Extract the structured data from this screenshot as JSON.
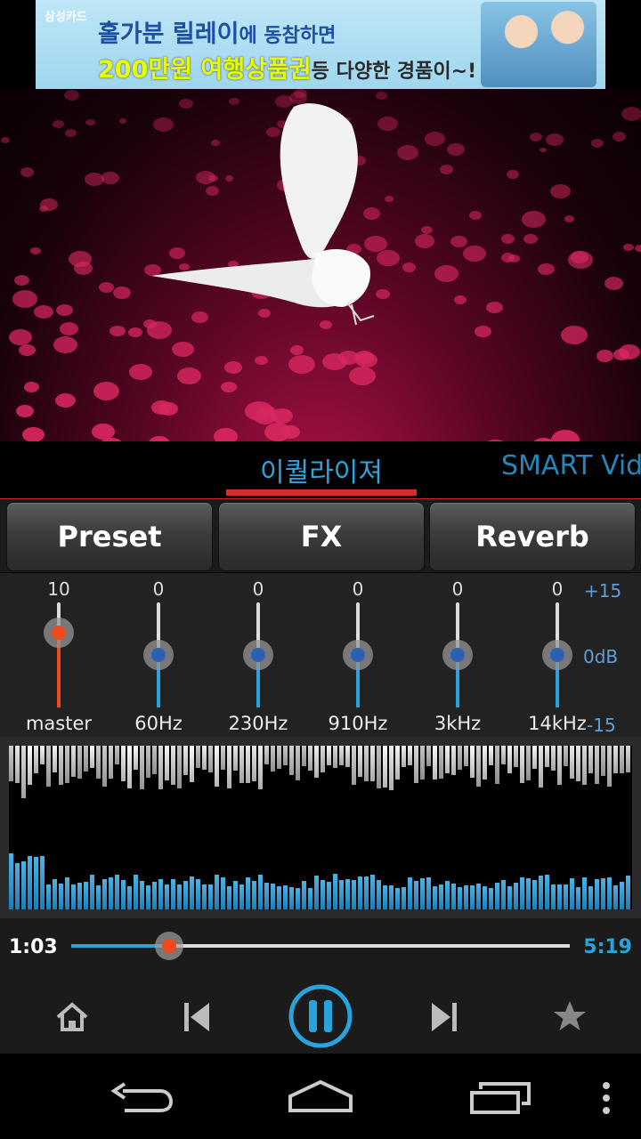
{
  "ad": {
    "brand": "삼성카드",
    "line1_a": "홀가분 릴레이",
    "line1_b": "에 동참하면",
    "line2_a": "200만원 여행상품권",
    "line2_b": "등 다양한 경품이",
    "line2_c": "~!"
  },
  "tabs": {
    "active": "이퀄라이져",
    "next": "SMART Vid"
  },
  "buttons": {
    "preset": "Preset",
    "fx": "FX",
    "reverb": "Reverb"
  },
  "eq": {
    "bands": [
      {
        "label": "master",
        "value": "10",
        "level": 0.71
      },
      {
        "label": "60Hz",
        "value": "0",
        "level": 0.5
      },
      {
        "label": "230Hz",
        "value": "0",
        "level": 0.5
      },
      {
        "label": "910Hz",
        "value": "0",
        "level": 0.5
      },
      {
        "label": "3kHz",
        "value": "0",
        "level": 0.5
      },
      {
        "label": "14kHz",
        "value": "0",
        "level": 0.5
      }
    ],
    "scale_top": "+15",
    "scale_mid": "0dB",
    "scale_bottom": "-15"
  },
  "player": {
    "current_time": "1:03",
    "total_time": "5:19",
    "progress": 0.197
  },
  "icons": {
    "home": "home-icon",
    "previous": "skip-previous-icon",
    "pause": "pause-icon",
    "next": "skip-next-icon",
    "favorite": "star-icon",
    "back": "back-icon",
    "recent": "recent-apps-icon",
    "menu": "overflow-menu-icon"
  },
  "colors": {
    "accent": "#29a3dc",
    "tab_indicator": "#d32f2f",
    "master": "#f04a1d"
  }
}
